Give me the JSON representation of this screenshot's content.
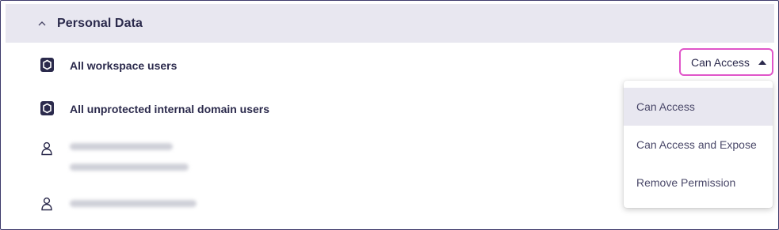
{
  "section": {
    "title": "Personal Data",
    "collapse_icon": "chevron-up-icon"
  },
  "rows": [
    {
      "icon": "hexagon-group-icon",
      "label": "All workspace users"
    },
    {
      "icon": "hexagon-group-icon",
      "label": "All unprotected internal domain users"
    },
    {
      "icon": "user-icon",
      "label": "(blurred email)"
    },
    {
      "icon": "user-icon",
      "label": "(blurred email)"
    }
  ],
  "access_select": {
    "value": "Can Access",
    "icon": "caret-up-icon",
    "highlight_color": "#e055c9"
  },
  "menu": {
    "options": [
      "Can Access",
      "Can Access and Expose",
      "Remove Permission"
    ],
    "selected": "Can Access"
  },
  "colors": {
    "header_bg": "#e8e7f0",
    "text": "#2b2a4c",
    "border": "#3d3a6b"
  }
}
